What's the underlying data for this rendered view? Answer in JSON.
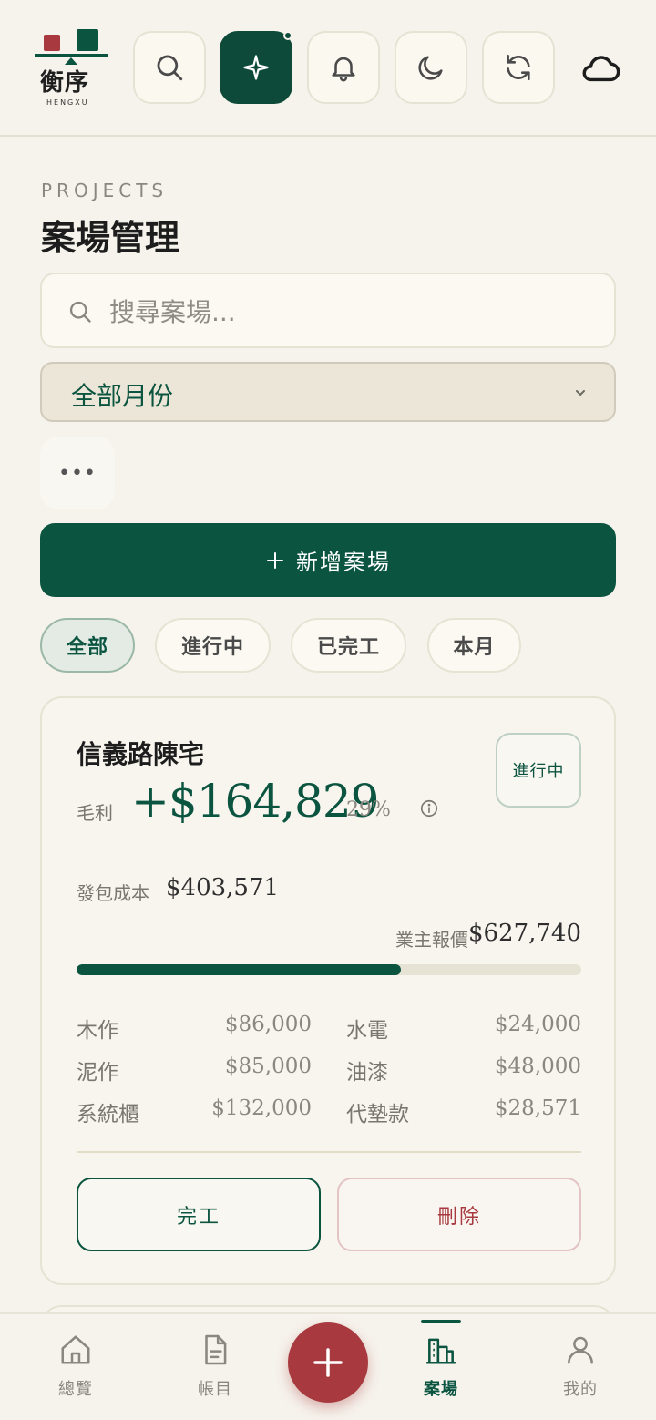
{
  "app": {
    "logo_text": "衡序",
    "logo_sub": "HENGXU"
  },
  "section": {
    "eyebrow": "PROJECTS",
    "title": "案場管理"
  },
  "search": {
    "placeholder": "搜尋案場..."
  },
  "month_filter": {
    "selected": "全部月份"
  },
  "more_label": "•••",
  "add_button": {
    "label": "新增案場"
  },
  "chips": [
    {
      "label": "全部",
      "active": true
    },
    {
      "label": "進行中",
      "active": false
    },
    {
      "label": "已完工",
      "active": false
    },
    {
      "label": "本月",
      "active": false
    }
  ],
  "project": {
    "name": "信義路陳宅",
    "status": "進行中",
    "gross_profit_label": "毛利",
    "gross_profit": "+$164,829",
    "gross_margin": "29%",
    "subcontract_label": "發包成本",
    "subcontract_cost": "$403,571",
    "quote_label": "業主報價",
    "quote": "$627,740",
    "cost_ratio": 0.643,
    "categories": [
      {
        "name": "木作",
        "amount": "$86,000"
      },
      {
        "name": "水電",
        "amount": "$24,000"
      },
      {
        "name": "泥作",
        "amount": "$85,000"
      },
      {
        "name": "油漆",
        "amount": "$48,000"
      },
      {
        "name": "系統櫃",
        "amount": "$132,000"
      },
      {
        "name": "代墊款",
        "amount": "$28,571"
      }
    ],
    "complete_label": "完工",
    "delete_label": "刪除"
  },
  "nav": {
    "items": [
      {
        "label": "總覽",
        "icon": "home-icon"
      },
      {
        "label": "帳目",
        "icon": "document-icon"
      },
      {
        "label": "案場",
        "icon": "buildings-icon",
        "active": true
      },
      {
        "label": "我的",
        "icon": "user-icon"
      }
    ]
  },
  "colors": {
    "brand_green": "#0a5440",
    "accent_red": "#a83a3f",
    "background": "#f6f3ec"
  }
}
